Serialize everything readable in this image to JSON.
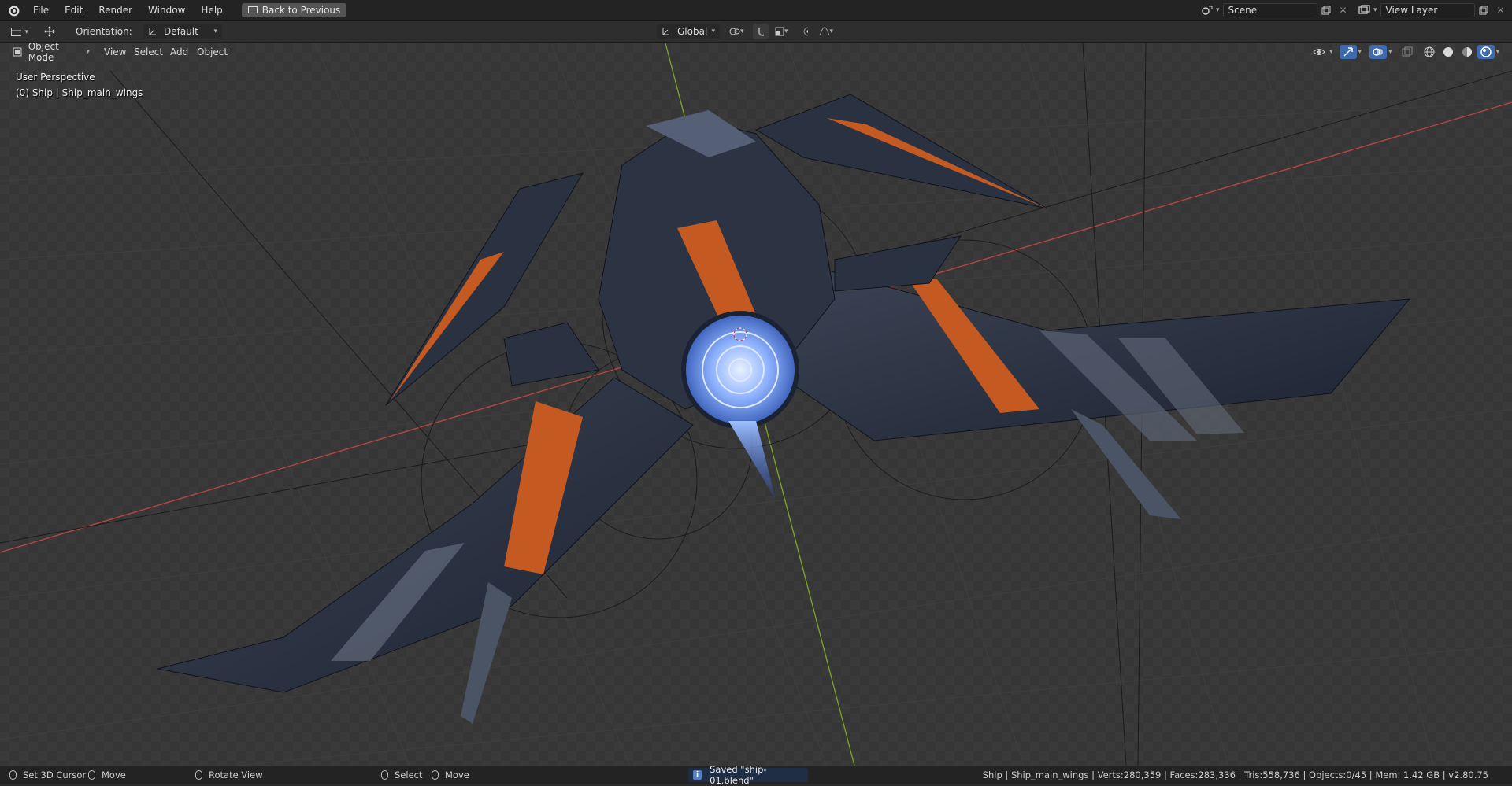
{
  "topbar": {
    "menus": [
      "File",
      "Edit",
      "Render",
      "Window",
      "Help"
    ],
    "back_label": "Back to Previous",
    "scene_name": "Scene",
    "view_layer_name": "View Layer"
  },
  "toolheader": {
    "orientation_label": "Orientation:",
    "orientation_value": "Default",
    "transform_orientation": "Global"
  },
  "viewheader": {
    "mode": "Object Mode",
    "menus": [
      "View",
      "Select",
      "Add",
      "Object"
    ]
  },
  "viewport": {
    "perspective_label": "User Perspective",
    "active_object_label": "(0) Ship | Ship_main_wings"
  },
  "statusbar": {
    "left_hints": [
      {
        "label": "Set 3D Cursor"
      },
      {
        "label": "Move"
      },
      {
        "label": "Rotate View"
      },
      {
        "label": "Select"
      },
      {
        "label": "Move"
      }
    ],
    "saved_message": "Saved \"ship-01.blend\"",
    "stats": "Ship | Ship_main_wings | Verts:280,359 | Faces:283,336 | Tris:558,736 | Objects:0/45 | Mem: 1.42 GB | v2.80.75"
  },
  "colors": {
    "x_axis": "#b54545",
    "y_axis": "#7aa02a",
    "ship_dark": "#2c3444",
    "ship_orange": "#c45a22",
    "engine_blue": "#7aa6ff"
  }
}
